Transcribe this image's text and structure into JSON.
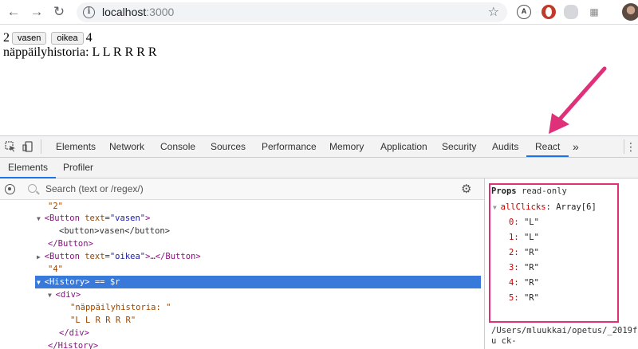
{
  "browser": {
    "url_host": "localhost",
    "url_port": ":3000"
  },
  "page": {
    "num_left": "2",
    "btn_left": "vasen",
    "btn_right": "oikea",
    "num_right": "4",
    "history_label": "näppäilyhistoria:",
    "history_value": "L L R R R R"
  },
  "devtools": {
    "tabs": [
      "Elements",
      "Network",
      "Console",
      "Sources",
      "Performance",
      "Memory",
      "Application",
      "Security",
      "Audits",
      "React"
    ],
    "more": "»",
    "subtabs": [
      "Elements",
      "Profiler"
    ],
    "search_placeholder": "Search (text or /regex/)",
    "tree": {
      "l0": "\"2\"",
      "l1_tag_open": "<Button",
      "l1_attr": "text",
      "l1_val": "\"vasen\"",
      "l1_close": ">",
      "l2": "<button>vasen</button>",
      "l3": "</Button>",
      "l4_tag_open": "<Button",
      "l4_attr": "text",
      "l4_val": "\"oikea\"",
      "l4_close": ">…</Button>",
      "l5": "\"4\"",
      "l6": "<History> == $r",
      "l7": "<div>",
      "l8": "\"näppäilyhistoria: \"",
      "l9": "\"L L R R R R\"",
      "l10": "</div>",
      "l11": "</History>"
    },
    "side": {
      "props_title": "Props",
      "props_note": "read-only",
      "key": "allClicks",
      "type": "Array[6]",
      "items": [
        {
          "i": "0",
          "v": "\"L\""
        },
        {
          "i": "1",
          "v": "\"L\""
        },
        {
          "i": "2",
          "v": "\"R\""
        },
        {
          "i": "3",
          "v": "\"R\""
        },
        {
          "i": "4",
          "v": "\"R\""
        },
        {
          "i": "5",
          "v": "\"R\""
        }
      ],
      "path": "/Users/mluukkai/opetus/_2019fu ck-"
    }
  },
  "colors": {
    "highlight": "#e0307a",
    "selection": "#3879d9",
    "active_tab": "#1a73e8"
  }
}
